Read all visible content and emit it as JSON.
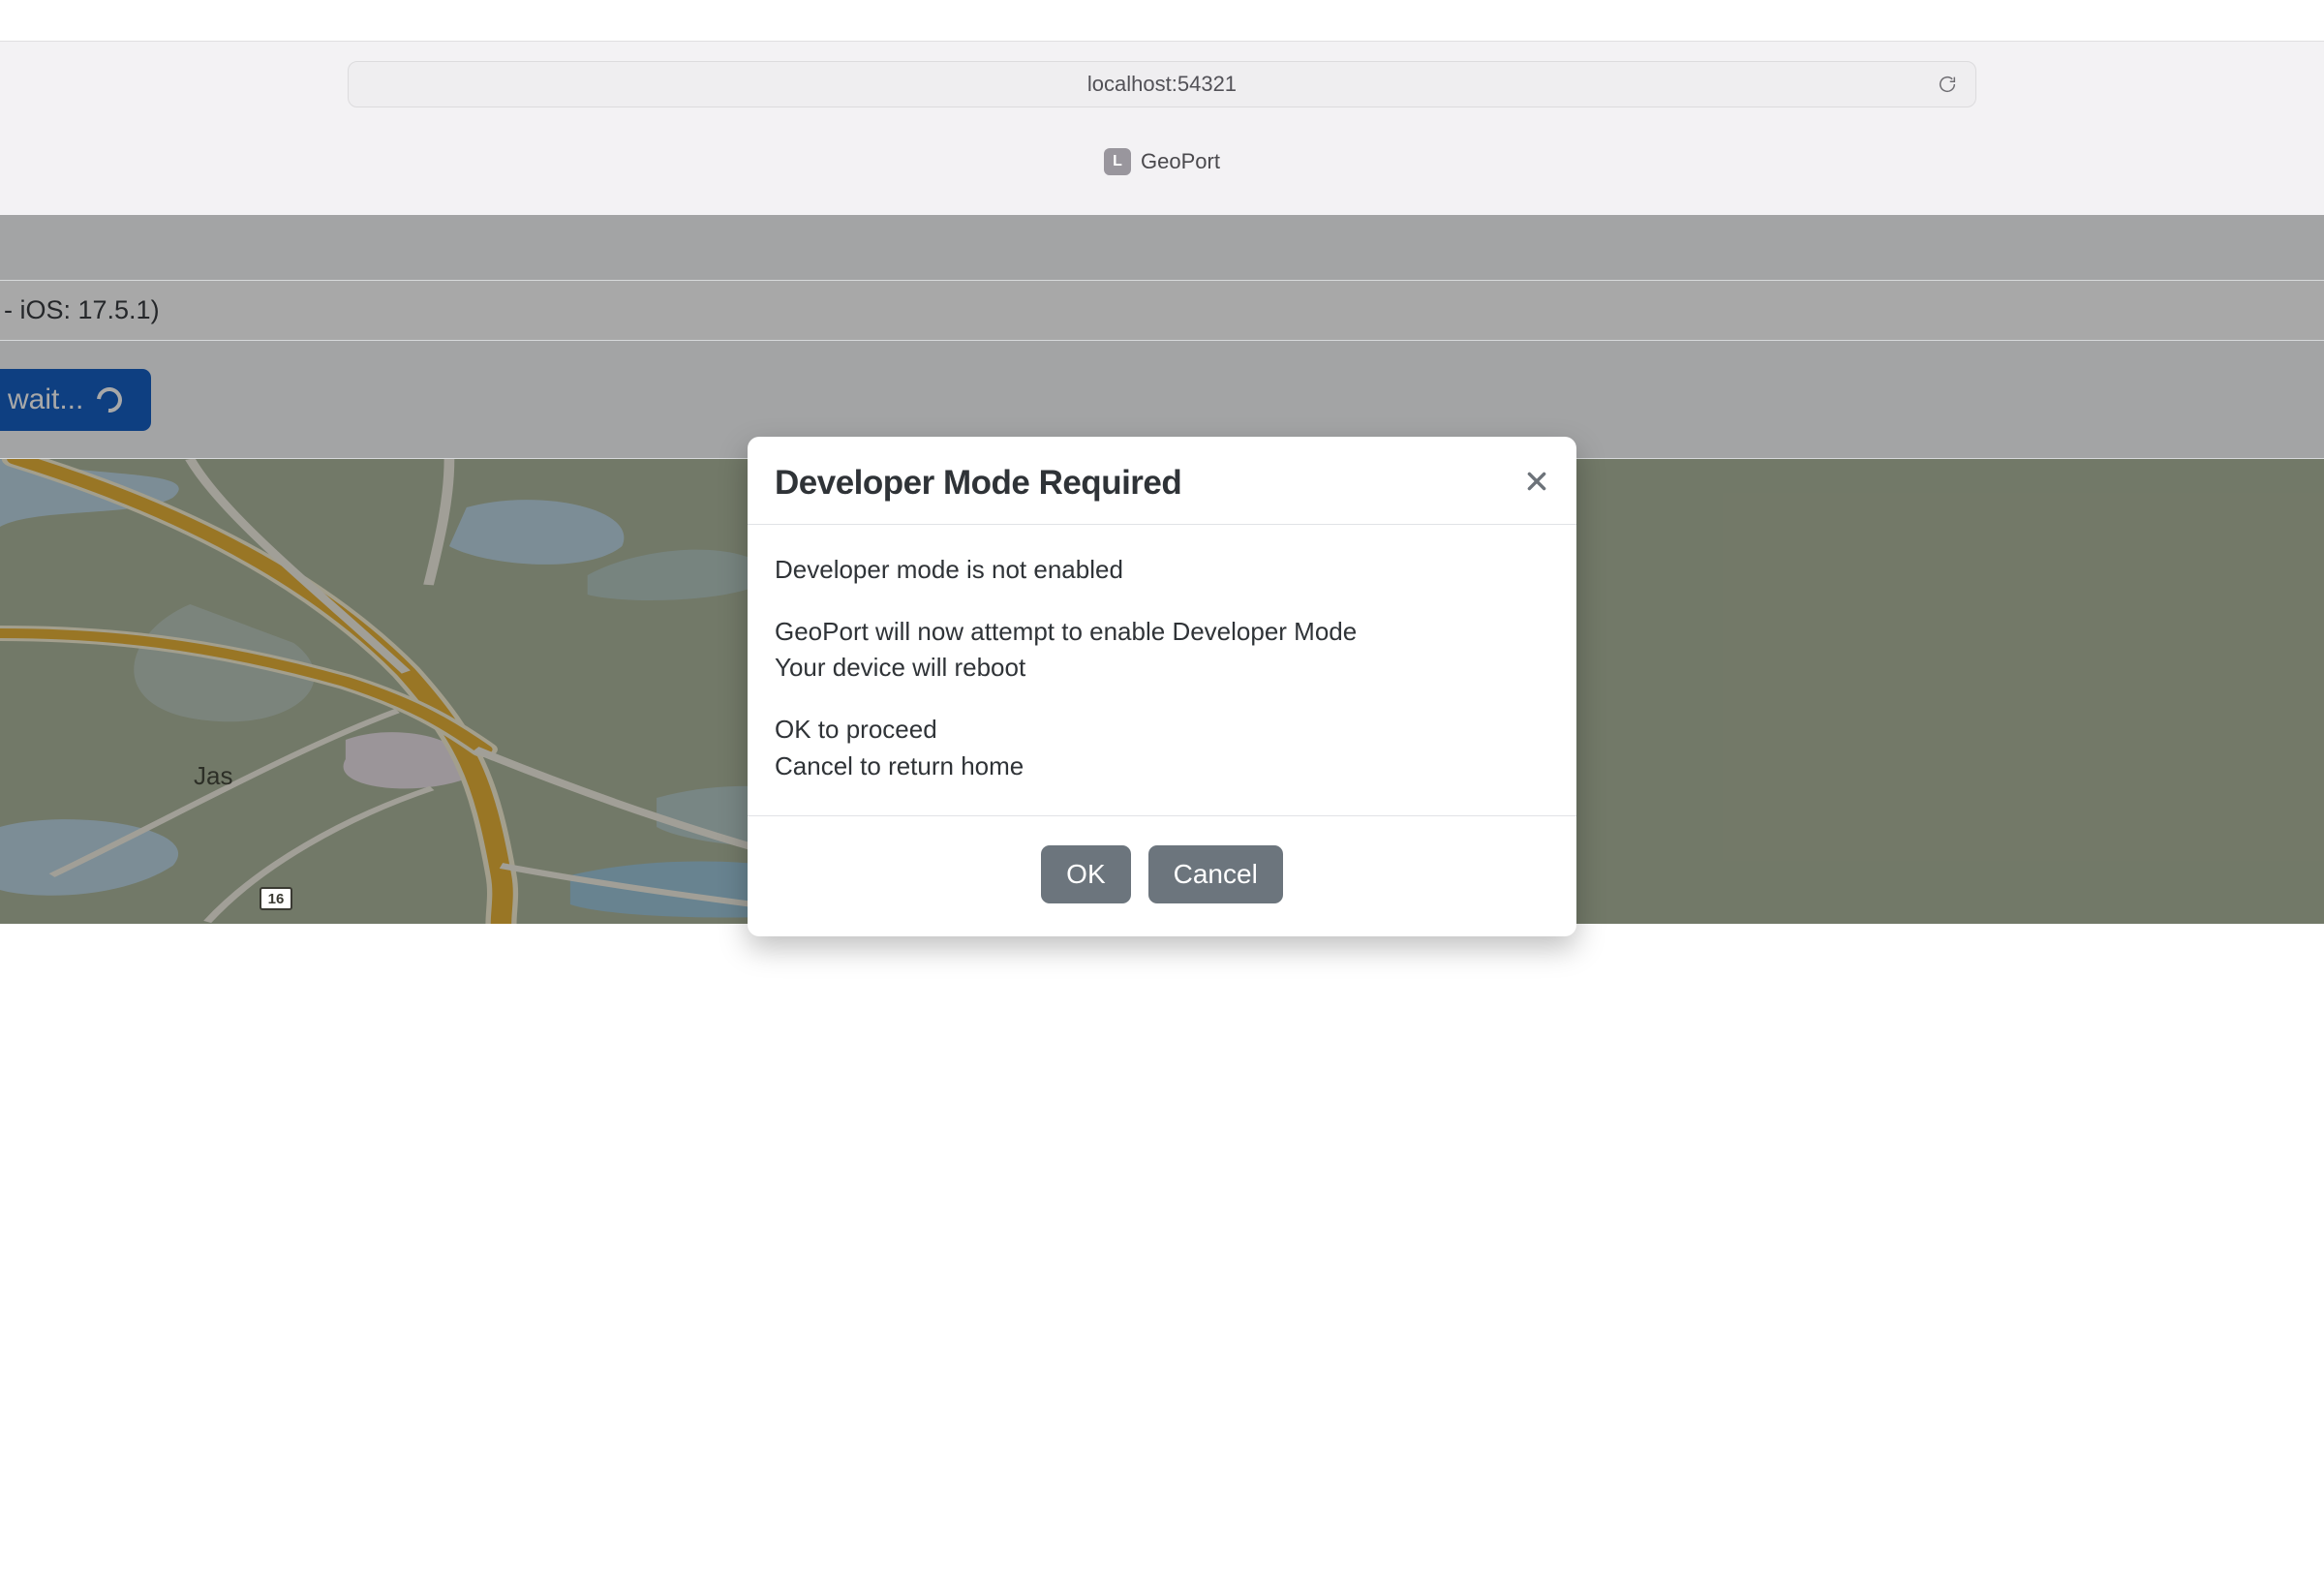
{
  "browser": {
    "url": "localhost:54321",
    "tab": {
      "icon_letter": "L",
      "title": "GeoPort"
    }
  },
  "device_info_fragment": " - iOS: 17.5.1)",
  "wait_button_label": "wait...",
  "map": {
    "city_label": "Jas",
    "route_shield": "16"
  },
  "modal": {
    "title": "Developer Mode Required",
    "body": {
      "line1": "Developer mode is not enabled",
      "line2": "GeoPort will now attempt to enable Developer Mode",
      "line3": "Your device will reboot",
      "line4": "OK to proceed",
      "line5": "Cancel to return home"
    },
    "ok_label": "OK",
    "cancel_label": "Cancel"
  }
}
